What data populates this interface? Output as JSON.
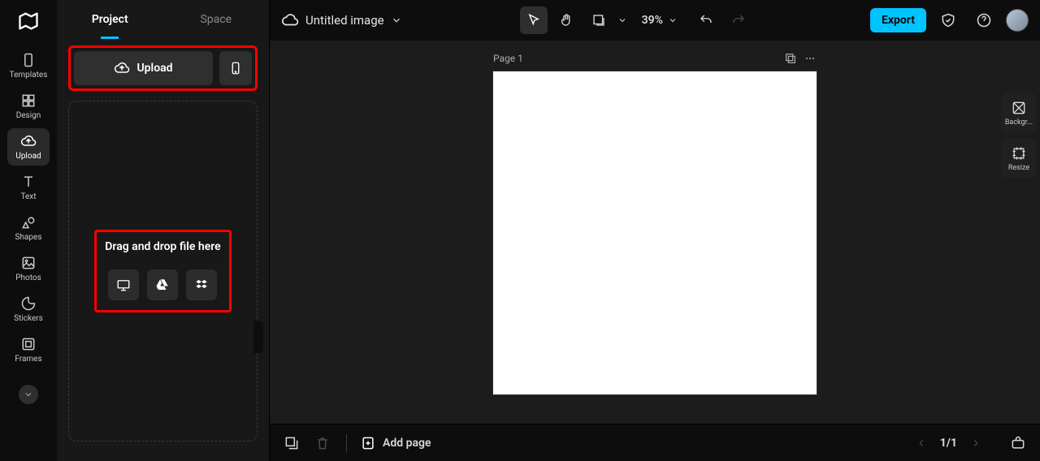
{
  "rail": {
    "items": [
      {
        "label": "Templates"
      },
      {
        "label": "Design"
      },
      {
        "label": "Upload"
      },
      {
        "label": "Text"
      },
      {
        "label": "Shapes"
      },
      {
        "label": "Photos"
      },
      {
        "label": "Stickers"
      },
      {
        "label": "Frames"
      }
    ]
  },
  "panel": {
    "tabs": {
      "project": "Project",
      "space": "Space"
    },
    "upload_label": "Upload",
    "drop_text": "Drag and drop file here"
  },
  "header": {
    "title": "Untitled image",
    "zoom": "39%",
    "export": "Export"
  },
  "right": {
    "background": "Backgr...",
    "resize": "Resize"
  },
  "canvas": {
    "page_label": "Page 1"
  },
  "bottom": {
    "add_page": "Add page",
    "pager": "1/1"
  }
}
